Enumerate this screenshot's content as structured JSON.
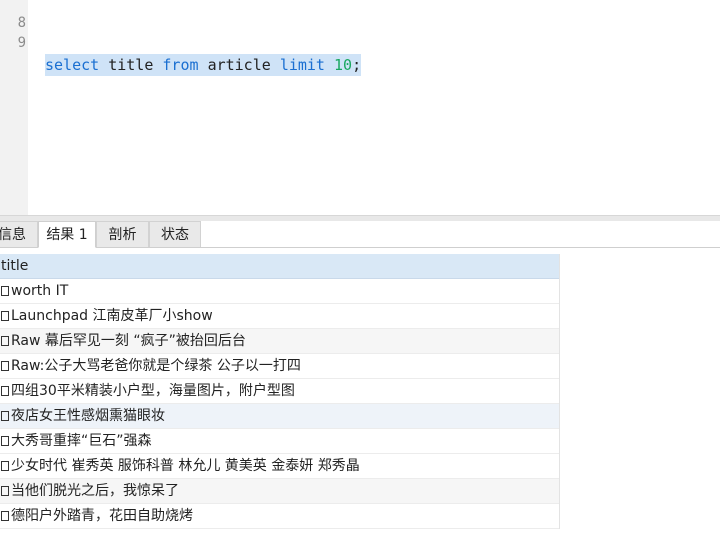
{
  "editor": {
    "lines": [
      {
        "no": "8"
      },
      {
        "no": "9",
        "tokens": {
          "kw1": "select",
          "id1": "title",
          "kw2": "from",
          "id2": "article",
          "kw3": "limit",
          "num": "10",
          "end": ";"
        }
      }
    ]
  },
  "tabs": [
    {
      "label": "信息"
    },
    {
      "label": "结果 1"
    },
    {
      "label": "剖析"
    },
    {
      "label": "状态"
    }
  ],
  "results": {
    "columns": [
      "title"
    ],
    "rows": [
      "worth IT",
      "Launchpad 江南皮革厂小show",
      "Raw 幕后罕见一刻 “疯子”被抬回后台",
      "Raw:公子大骂老爸你就是个绿茶  公子以一打四",
      "四组30平米精装小户型，海量图片，附户型图",
      "夜店女王性感烟熏猫眼妆",
      "大秀哥重摔“巨石”强森",
      "少女时代 崔秀英 服饰科普 林允儿 黄美英 金泰妍 郑秀晶",
      "当他们脱光之后，我惊呆了",
      "德阳户外踏青，花田自助烧烤"
    ]
  },
  "colors": {
    "keyword": "#1a6fd1",
    "number": "#19a85f",
    "selection": "#cfe3f7",
    "header_bg": "#d9e8f6"
  }
}
